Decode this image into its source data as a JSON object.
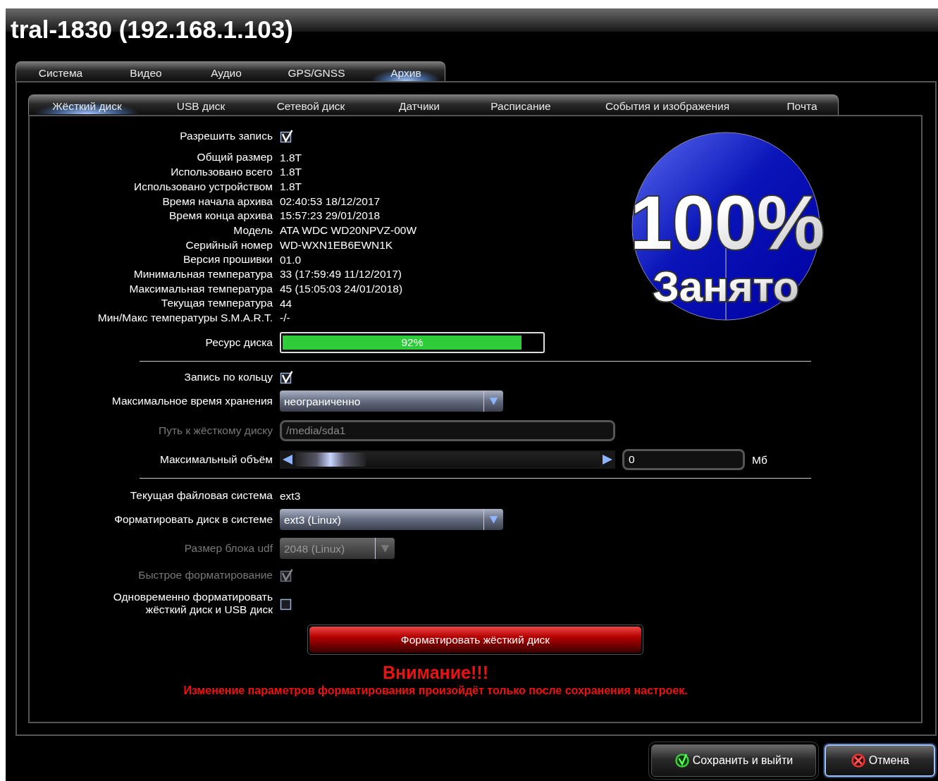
{
  "window": {
    "title": "tral-1830 (192.168.1.103)"
  },
  "tabs": [
    {
      "label": "Система",
      "selected": false
    },
    {
      "label": "Видео",
      "selected": false
    },
    {
      "label": "Аудио",
      "selected": false
    },
    {
      "label": "GPS/GNSS",
      "selected": false
    },
    {
      "label": "Архив",
      "selected": true
    }
  ],
  "subtabs": [
    {
      "label": "Жёсткий диск",
      "selected": true
    },
    {
      "label": "USB диск",
      "selected": false
    },
    {
      "label": "Сетевой диск",
      "selected": false
    },
    {
      "label": "Датчики",
      "selected": false
    },
    {
      "label": "Расписание",
      "selected": false
    },
    {
      "label": "События и изображения",
      "selected": false
    },
    {
      "label": "Почта",
      "selected": false
    }
  ],
  "status_rows": [
    {
      "kind": "checkbox",
      "label": "Разрешить запись",
      "checked": true,
      "disabled": false
    },
    {
      "kind": "info",
      "label": "Общий размер",
      "value": "1.8T"
    },
    {
      "kind": "info",
      "label": "Использовано всего",
      "value": "1.8T"
    },
    {
      "kind": "info",
      "label": "Использовано устройством",
      "value": "1.8T"
    },
    {
      "kind": "info",
      "label": "Время начала архива",
      "value": "02:40:53 18/12/2017"
    },
    {
      "kind": "info",
      "label": "Время конца архива",
      "value": "15:57:23 29/01/2018"
    },
    {
      "kind": "info",
      "label": "Модель",
      "value": "ATA WDC WD20NPVZ-00W"
    },
    {
      "kind": "info",
      "label": "Серийный номер",
      "value": "WD-WXN1EB6EWN1K"
    },
    {
      "kind": "info",
      "label": "Версия прошивки",
      "value": "01.0"
    },
    {
      "kind": "info",
      "label": "Минимальная температура",
      "value": "33 (17:59:49 11/12/2017)"
    },
    {
      "kind": "info",
      "label": "Максимальная температура",
      "value": "45 (15:05:03 24/01/2018)"
    },
    {
      "kind": "info",
      "label": "Текущая температура",
      "value": "44"
    },
    {
      "kind": "info",
      "label": "Мин/Макс температуры S.M.A.R.T.",
      "value": "-/-"
    },
    {
      "kind": "progress",
      "label": "Ресурс диска",
      "level": 0.92,
      "reading": "92%"
    }
  ],
  "usage": {
    "reading": "100%",
    "caption": "Занято"
  },
  "settings_rows": [
    {
      "kind": "separator"
    },
    {
      "kind": "checkbox",
      "label": "Запись по кольцу",
      "checked": true,
      "disabled": false
    },
    {
      "kind": "dropdown",
      "label": "Максимальное время хранения",
      "value": "неограниченно",
      "disabled": false
    },
    {
      "kind": "text",
      "label": "Путь к жёсткому диску",
      "value": "/media/sda1",
      "disabled": true
    },
    {
      "kind": "slider",
      "label": "Максимальный объём",
      "level": 0,
      "value": "0",
      "unit": "Мб"
    },
    {
      "kind": "separator"
    },
    {
      "kind": "info",
      "label": "Текущая файловая система",
      "value": "ext3"
    },
    {
      "kind": "dropdown",
      "label": "Форматировать диск в системе",
      "value": "ext3 (Linux)",
      "disabled": false
    },
    {
      "kind": "dropdown",
      "label": "Размер блока udf",
      "value": "2048 (Linux)",
      "disabled": true
    },
    {
      "kind": "checkbox",
      "label": "Быстрое форматирование",
      "checked": true,
      "disabled": true
    },
    {
      "kind": "checkbox",
      "label": "Одновременно форматировать\nжёсткий диск и USB диск",
      "checked": false,
      "disabled": false
    }
  ],
  "format_button": "Форматировать жёсткий диск",
  "warning": {
    "title": "Внимание!!!",
    "text": "Изменение параметров форматирования произойдёт только после сохранения настроек."
  },
  "buttons": [
    {
      "kind": "save",
      "label": "Сохранить и выйти",
      "focused": false
    },
    {
      "kind": "cancel",
      "label": "Отмена",
      "focused": true
    }
  ]
}
